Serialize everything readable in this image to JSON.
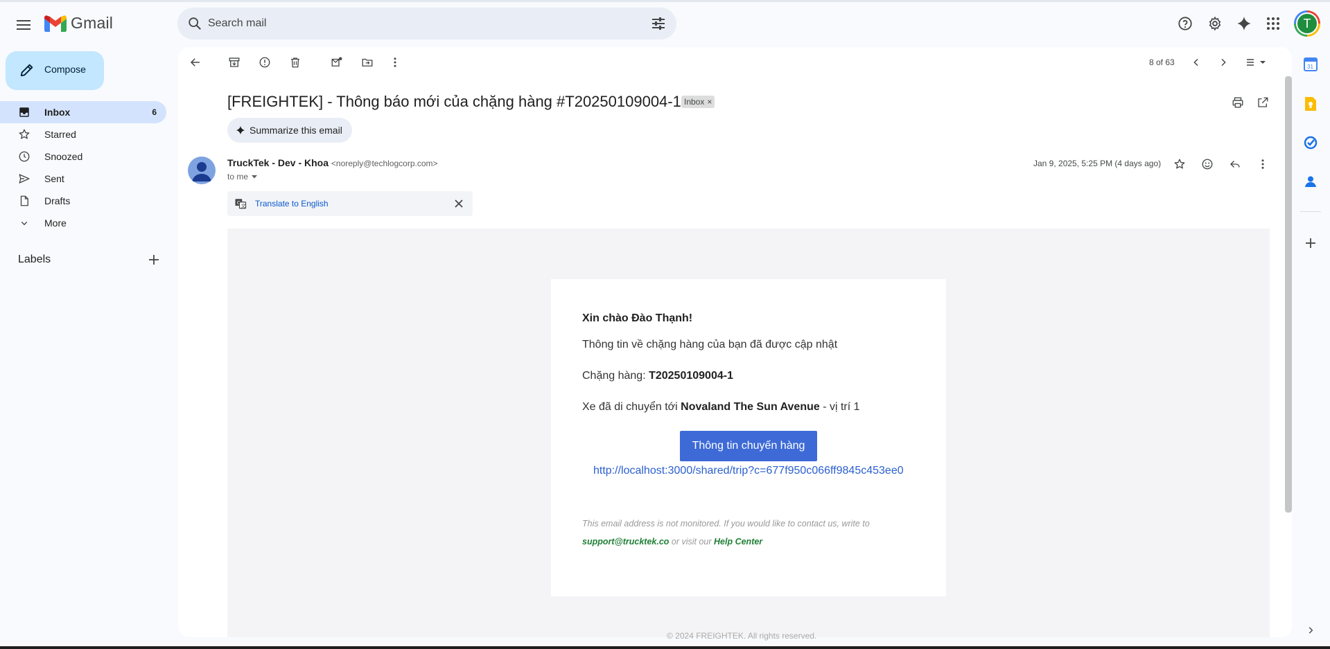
{
  "header": {
    "app_name": "Gmail",
    "search_placeholder": "Search mail",
    "avatar_initial": "T"
  },
  "compose": {
    "label": "Compose"
  },
  "sidebar": {
    "items": [
      {
        "label": "Inbox",
        "count": "6",
        "icon": "inbox-icon",
        "active": true
      },
      {
        "label": "Starred",
        "count": "",
        "icon": "star-icon"
      },
      {
        "label": "Snoozed",
        "count": "",
        "icon": "clock-icon"
      },
      {
        "label": "Sent",
        "count": "",
        "icon": "send-icon"
      },
      {
        "label": "Drafts",
        "count": "",
        "icon": "draft-icon"
      },
      {
        "label": "More",
        "count": "",
        "icon": "chevron-down-icon"
      }
    ],
    "labels_heading": "Labels"
  },
  "toolbar": {
    "pager": "8 of 63"
  },
  "email": {
    "subject": "[FREIGHTEK] - Thông báo mới của chặng hàng #T20250109004-1",
    "label_chip": "Inbox",
    "summarize_label": "Summarize this email",
    "sender_name": "TruckTek - Dev - Khoa",
    "sender_email": "<noreply@techlogcorp.com>",
    "to": "to me",
    "date": "Jan 9, 2025, 5:25 PM (4 days ago)",
    "translate_label": "Translate to English"
  },
  "body": {
    "greeting": "Xin chào Đào Thạnh!",
    "line1": "Thông tin về chặng hàng của bạn đã được cập nhật",
    "leg_prefix": "Chặng hàng: ",
    "leg_code": "T20250109004-1",
    "move_prefix": "Xe đã di chuyển tới ",
    "move_place": "Novaland The Sun Avenue",
    "move_suffix": " - vị trí 1",
    "button_label": "Thông tin chuyến hàng",
    "link": "http://localhost:3000/shared/trip?c=677f950c066ff9845c453ee0",
    "note_line1": "This email address is not monitored. If you would like to contact us, write to",
    "support_email": "support@trucktek.co",
    "note_mid": " or visit our ",
    "help_center": "Help Center",
    "footer": "© 2024 FREIGHTEK. All rights reserved."
  },
  "colors": {
    "accent": "#0b57d0",
    "compose_bg": "#c2e7ff",
    "active_nav": "#d3e3fd",
    "cta": "#3d6ad6"
  }
}
